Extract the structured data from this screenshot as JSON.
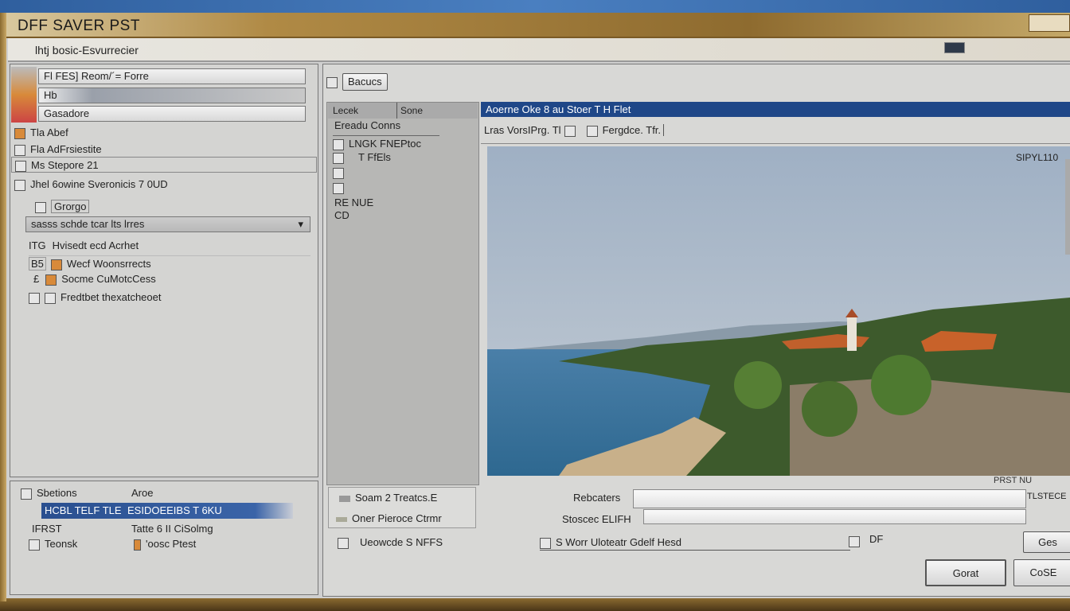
{
  "window": {
    "title": "DFF SAVER PST",
    "subtitle": "lhtj bosic-Esvurrecier"
  },
  "left_panel": {
    "fields": [
      "Fl FES] Reom/´= Forre",
      "Hb",
      "Gasadore"
    ],
    "items": [
      "Tla Abef",
      "Fla AdFrsiestite",
      "Ms Stepore 21",
      "Jhel 6owine  Sveronicis  7 0UD"
    ],
    "group_label": "Grorgo",
    "dropdown": "sasss schde tcar lts lrres",
    "tree": [
      "Hvisedt ecd  Acrhet",
      "Wecf Woonsrrects",
      "Socme CuMotcCess",
      "Fredtbet thexatcheoet"
    ],
    "tree_prefix": [
      "ITG",
      "B5",
      "£",
      ""
    ]
  },
  "bottom_left": {
    "header": [
      "Sbetions",
      "Aroe"
    ],
    "selected": [
      "HCBL TELF TLE",
      "ESIDOEEIBS T 6KU"
    ],
    "rows": [
      [
        "IFRST",
        "Tatte 6 II CiSolmg"
      ],
      [
        "Teonsk",
        "'oosc Ptest"
      ]
    ]
  },
  "toolbar": {
    "button": "Bacucs"
  },
  "file_list": {
    "columns": [
      "Lecek",
      "Sone"
    ],
    "items": [
      "Ereadu Conns",
      "LNGK FNEPtoc",
      "T FfEls",
      "",
      "",
      "RE NUE",
      "CD"
    ]
  },
  "preview": {
    "header": "Aoerne Oke 8 au Stoer T H Flet",
    "path": "Lras VorsIPrg. Tl",
    "path2": "Fergdce. Tfr.",
    "size_label": "SIPYL110",
    "corner": "PRST NU"
  },
  "options": {
    "items": [
      "Soam 2 Treatcs.E",
      "Oner Pieroce Ctrmr"
    ],
    "checkbox": "Ueowcde S NFFS"
  },
  "form": {
    "label1": "Rebcaters",
    "value1": "",
    "label2": "Stoscec ELIFH",
    "value2": "",
    "side": "TLSTECE",
    "checkbox": "S Worr Uloteatr Gdelf Hesd",
    "suffix": "DF"
  },
  "buttons": {
    "ges": "Ges",
    "gorat": "Gorat",
    "close": "CoSE"
  }
}
